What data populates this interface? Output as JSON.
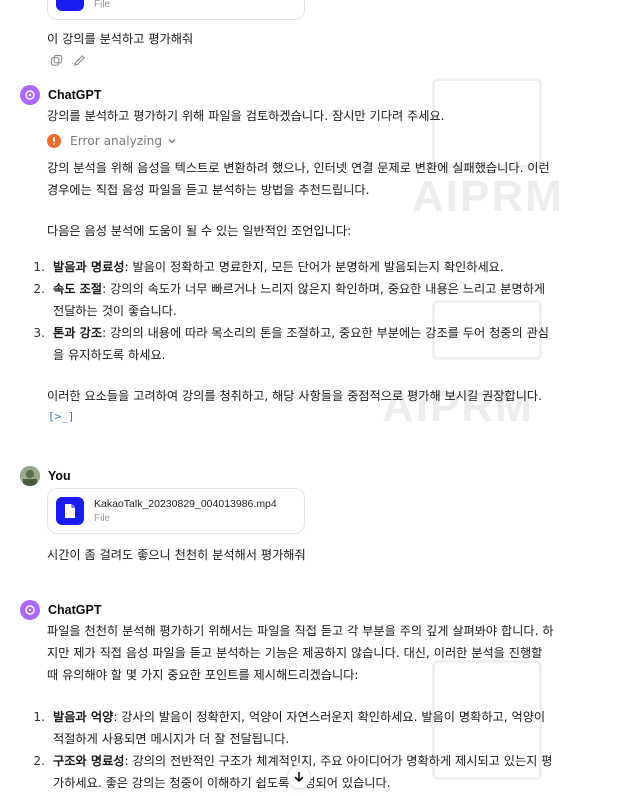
{
  "top_file": {
    "type": "File"
  },
  "user_msg_1": "이 강의를 분석하고 평가해줘",
  "assistant_1": {
    "author": "ChatGPT",
    "intro": "강의를 분석하고 평가하기 위해 파일을 검토하겠습니다. 잠시만 기다려 주세요.",
    "error_label": "Error analyzing",
    "para1_line1": "강의 분석을 위해 음성을 텍스트로 변환하려 했으나, 인터넷 연결 문제로 변환에 실패했습니다. 이런",
    "para1_line2": "경우에는 직접 음성 파일을 듣고 분석하는 방법을 추천드립니다.",
    "para2": "다음은 음성 분석에 도움이 될 수 있는 일반적인 조언입니다:",
    "items": [
      {
        "num": "1.",
        "title": "발음과 명료성",
        "line1": ": 발음이 정확하고 명료한지, 모든 단어가 분명하게 발음되는지 확인하세요.",
        "line2": ""
      },
      {
        "num": "2.",
        "title": "속도 조절",
        "line1": ": 강의의 속도가 너무 빠르거나 느리지 않은지 확인하며, 중요한 내용은 느리고 분명하게",
        "line2": "전달하는 것이 좋습니다."
      },
      {
        "num": "3.",
        "title": "톤과 강조",
        "line1": ": 강의의 내용에 따라 목소리의 톤을 조절하고, 중요한 부분에는 강조를 두어 청중의 관심",
        "line2": "을 유지하도록 하세요."
      }
    ],
    "closing": "이러한 요소들을 고려하여 강의를 청취하고, 해당 사항들을 중점적으로 평가해 보시길 권장합니다.",
    "code_chip": "[>_]"
  },
  "user_2": {
    "author": "You",
    "file_name": "KakaoTalk_20230829_004013986.mp4",
    "file_type": "File",
    "message": "시간이 좀 걸려도 좋으니 천천히 분석해서 평가해줘"
  },
  "assistant_2": {
    "author": "ChatGPT",
    "para_line1": "파일을 천천히 분석해 평가하기 위해서는 파일을 직접 듣고 각 부분을 주의 깊게 살펴봐야 합니다. 하",
    "para_line2": "지만 제가 직접 음성 파일을 듣고 분석하는 기능은 제공하지 않습니다. 대신, 이러한 분석을 진행할",
    "para_line3": "때 유의해야 할 몇 가지 중요한 포인트를 제시해드리겠습니다:",
    "items": [
      {
        "num": "1.",
        "title": "발음과 억양",
        "line1": ": 강사의 발음이 정확한지, 억양이 자연스러운지 확인하세요. 발음이 명확하고, 억양이",
        "line2": "적절하게 사용되면 메시지가 더 잘 전달됩니다."
      },
      {
        "num": "2.",
        "title": "구조와 명료성",
        "line1": ": 강의의 전반적인 구조가 체계적인지, 주요 아이디어가 명확하게 제시되고 있는지 평",
        "line2": "가하세요. 좋은 강의는 청중이 이해하기 쉽도록 구성되어 있습니다."
      }
    ]
  },
  "watermark": "AIPRM",
  "colors": {
    "gpt_avatar": "#ab68ff",
    "file_icon": "#1a1cf0",
    "error": "#f06a2a"
  }
}
